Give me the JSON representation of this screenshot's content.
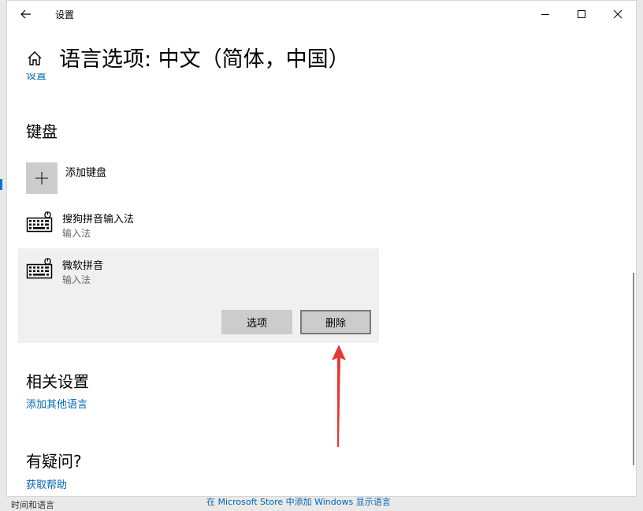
{
  "window": {
    "title": "设置",
    "back_icon": "arrow-left-icon",
    "minimize_icon": "minimize-icon",
    "maximize_icon": "maximize-icon",
    "close_icon": "close-icon"
  },
  "header": {
    "home_icon": "home-icon",
    "title": "语言选项: 中文（简体，中国）",
    "breadcrumb": "设置"
  },
  "keyboard_section": {
    "heading": "键盘",
    "add_label": "添加键盘",
    "items": [
      {
        "name": "搜狗拼音输入法",
        "subtitle": "输入法",
        "icon": "keyboard-icon"
      },
      {
        "name": "微软拼音",
        "subtitle": "输入法",
        "icon": "keyboard-icon",
        "selected": true
      }
    ],
    "options_button": "选项",
    "delete_button": "删除"
  },
  "related_section": {
    "heading": "相关设置",
    "link": "添加其他语言"
  },
  "faq_section": {
    "heading": "有疑问?",
    "link": "获取帮助"
  },
  "background": {
    "bottom_text": "在 Microsoft Store 中添加 Windows 显示语言",
    "bottom_left_text": "时间和语言"
  },
  "colors": {
    "accent_link": "#0066b4",
    "selected_bg": "#f0f0f0",
    "button_bg": "#cccccc",
    "annotation_arrow": "#e53935"
  }
}
